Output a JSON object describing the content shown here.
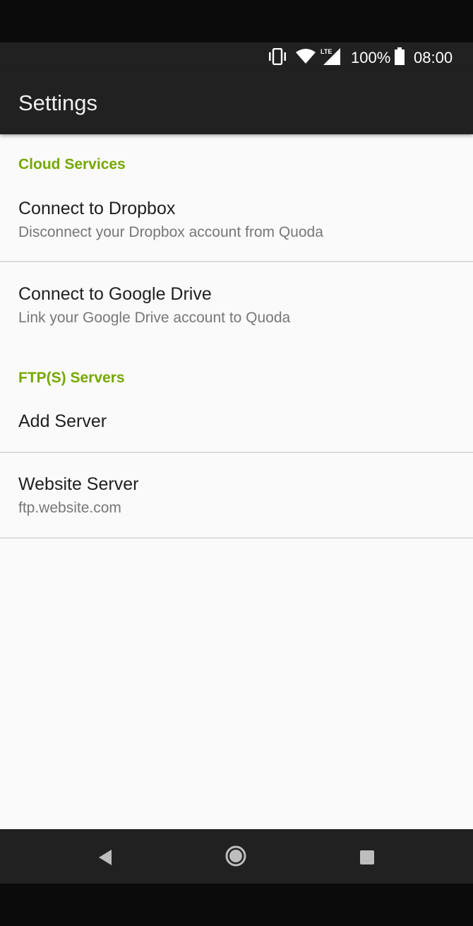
{
  "status_bar": {
    "battery_percent": "100%",
    "time": "08:00",
    "icons": [
      "vibrate-icon",
      "wifi-icon",
      "lte-signal-icon",
      "battery-icon"
    ],
    "lte_label": "LTE"
  },
  "app_bar": {
    "title": "Settings"
  },
  "sections": {
    "cloud": {
      "header": "Cloud Services",
      "items": [
        {
          "title": "Connect to Dropbox",
          "subtitle": "Disconnect your Dropbox account from Quoda"
        },
        {
          "title": "Connect to Google Drive",
          "subtitle": "Link your Google Drive account to Quoda"
        }
      ]
    },
    "ftp": {
      "header": "FTP(S) Servers",
      "items": [
        {
          "title": "Add Server"
        },
        {
          "title": "Website Server",
          "subtitle": "ftp.website.com"
        }
      ]
    }
  },
  "nav_bar": {
    "icons": [
      "back-icon",
      "home-icon",
      "recents-icon"
    ]
  },
  "colors": {
    "accent": "#76a800",
    "app_bar": "#212121",
    "background": "#fafafa"
  }
}
